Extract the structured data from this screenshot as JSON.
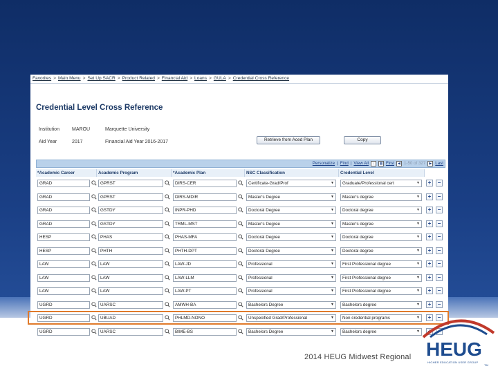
{
  "breadcrumb": [
    "Favorites",
    "Main Menu",
    "Set Up SACR",
    "Product Related",
    "Financial Aid",
    "Loans",
    "GULA",
    "Credential Cross Reference"
  ],
  "page_title": "Credential Level Cross Reference",
  "institution": {
    "label": "Institution",
    "code": "MAROU",
    "name": "Marquette University"
  },
  "aid_year": {
    "label": "Aid Year",
    "value": "2017",
    "name": "Financial Aid Year 2016-2017"
  },
  "buttons": {
    "retrieve": "Retrieve from Aced Plan",
    "copy": "Copy"
  },
  "grid_nav": {
    "personalize": "Personalize",
    "find": "Find",
    "view_all": "View All",
    "first": "First",
    "range": "1-50 of 327",
    "last": "Last"
  },
  "columns": [
    "*Academic Career",
    "Academic Program",
    "*Academic Plan",
    "NSC Classification",
    "Credential Level"
  ],
  "rows": [
    {
      "career": "GRAD",
      "program": "GPRST",
      "plan": "DIRS-CER",
      "nsc": "Certificate-Grad/Prof",
      "level": "Graduate/Professional cert"
    },
    {
      "career": "GRAD",
      "program": "GPRST",
      "plan": "DIRS-MDIR",
      "nsc": "Master's Degree",
      "level": "Master's degree"
    },
    {
      "career": "GRAD",
      "program": "GSTDY",
      "plan": "INPR-PHD",
      "nsc": "Doctoral Degree",
      "level": "Doctoral degree"
    },
    {
      "career": "GRAD",
      "program": "GSTDY",
      "plan": "TRML-MST",
      "nsc": "Master's Degree",
      "level": "Master's degree"
    },
    {
      "career": "HESP",
      "program": "PHAS",
      "plan": "PHAS-MFA",
      "nsc": "Doctoral Degree",
      "level": "Doctoral degree"
    },
    {
      "career": "HESP",
      "program": "PHTH",
      "plan": "PHTH-DPT",
      "nsc": "Doctoral Degree",
      "level": "Doctoral degree"
    },
    {
      "career": "LAW",
      "program": "LAW",
      "plan": "LAW-JD",
      "nsc": "Professional",
      "level": "First Professional degree"
    },
    {
      "career": "LAW",
      "program": "LAW",
      "plan": "LAW-LLM",
      "nsc": "Professional",
      "level": "First Professional degree"
    },
    {
      "career": "LAW",
      "program": "LAW",
      "plan": "LAW-PT",
      "nsc": "Professional",
      "level": "First Professional degree"
    },
    {
      "career": "UGRD",
      "program": "UARSC",
      "plan": "AMWH-BA",
      "nsc": "Bachelors Degree",
      "level": "Bachelors degree"
    },
    {
      "career": "UGRD",
      "program": "UBUAD",
      "plan": "PHLMD-NONO",
      "nsc": "Unspecified Grad/Professional",
      "level": "Non credential programs"
    },
    {
      "career": "UGRD",
      "program": "UARSC",
      "plan": "BIME-BS",
      "nsc": "Bachelors Degree",
      "level": "Bachelors degree"
    }
  ],
  "footer": "2014 HEUG Midwest Regional",
  "logo": {
    "word": "HEUG",
    "tagline": "HIGHER EDUCATION USER GROUP",
    "tm": "TM"
  },
  "colors": {
    "highlight": "#e07a2a",
    "brand": "#1e4c8f",
    "accent_red": "#c0392b"
  }
}
